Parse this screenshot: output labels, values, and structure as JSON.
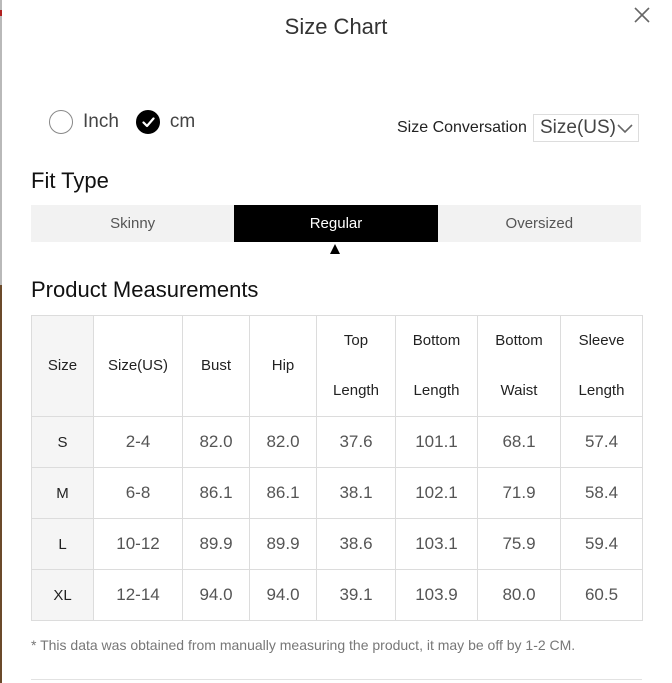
{
  "dialog": {
    "title": "Size Chart"
  },
  "unit_options": [
    {
      "label": "Inch",
      "checked": false
    },
    {
      "label": "cm",
      "checked": true
    }
  ],
  "size_conversion": {
    "label": "Size Conversation",
    "selected": "Size(US)"
  },
  "fit_type": {
    "heading": "Fit Type",
    "tabs": [
      {
        "label": "Skinny",
        "active": false
      },
      {
        "label": "Regular",
        "active": true
      },
      {
        "label": "Oversized",
        "active": false
      }
    ]
  },
  "product_measurements": {
    "heading": "Product Measurements",
    "columns": [
      {
        "line1": "Size",
        "line2": ""
      },
      {
        "line1": "Size(US)",
        "line2": ""
      },
      {
        "line1": "Bust",
        "line2": ""
      },
      {
        "line1": "Hip",
        "line2": ""
      },
      {
        "line1": "Top",
        "line2": "Length"
      },
      {
        "line1": "Bottom",
        "line2": "Length"
      },
      {
        "line1": "Bottom",
        "line2": "Waist"
      },
      {
        "line1": "Sleeve",
        "line2": "Length"
      }
    ],
    "rows": [
      [
        "S",
        "2-4",
        "82.0",
        "82.0",
        "37.6",
        "101.1",
        "68.1",
        "57.4"
      ],
      [
        "M",
        "6-8",
        "86.1",
        "86.1",
        "38.1",
        "102.1",
        "71.9",
        "58.4"
      ],
      [
        "L",
        "10-12",
        "89.9",
        "89.9",
        "38.6",
        "103.1",
        "75.9",
        "59.4"
      ],
      [
        "XL",
        "12-14",
        "94.0",
        "94.0",
        "39.1",
        "103.9",
        "80.0",
        "60.5"
      ]
    ]
  },
  "footnote": "* This data was obtained from manually measuring the product, it may be off by 1-2 CM.",
  "icons": {
    "close": "close-icon",
    "check": "check-icon",
    "dropdown": "chevron-down-icon",
    "active_tab_pointer": "triangle-up-icon"
  },
  "colors": {
    "active_tab_bg": "#000000",
    "tab_bg": "#f2f2f2",
    "size_column_bg": "#f5f5f5"
  }
}
